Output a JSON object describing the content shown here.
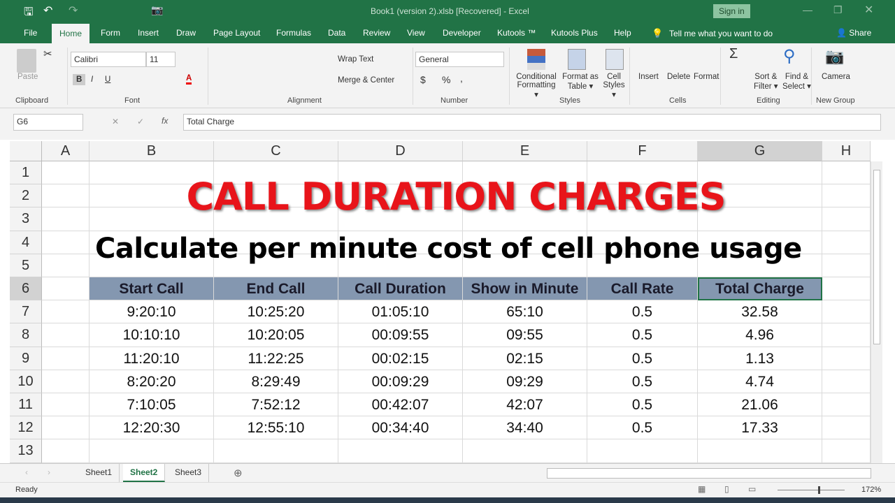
{
  "app": {
    "window_title": "Book1 (version 2).xlsb [Recovered]  -  Excel",
    "sign_in": "Sign in",
    "accent": "#217346"
  },
  "ribbon_tabs": [
    "File",
    "Home",
    "Form",
    "Insert",
    "Draw",
    "Page Layout",
    "Formulas",
    "Data",
    "Review",
    "View",
    "Developer",
    "Kutools ™",
    "Kutools Plus",
    "Help"
  ],
  "tell_me": "Tell me what you want to do",
  "share": "Share",
  "ribbon": {
    "paste": "Paste",
    "font_name": "Calibri",
    "font_size": "11",
    "bold": "B",
    "italic": "I",
    "underline": "U",
    "wrap_text": "Wrap Text",
    "merge_center": "Merge & Center",
    "number_format": "General",
    "currency": "$",
    "percent": "%",
    "comma": ",",
    "conditional": "Conditional",
    "formatting": "Formatting",
    "format_as": "Format as",
    "table": "Table",
    "cell": "Cell",
    "styles_btn": "Styles",
    "insert": "Insert",
    "delete": "Delete",
    "format": "Format",
    "sort": "Sort &",
    "filter": "Filter",
    "find": "Find &",
    "select": "Select",
    "camera": "Camera",
    "groups": [
      "Clipboard",
      "Font",
      "Alignment",
      "Number",
      "Styles",
      "Cells",
      "Editing",
      "New Group"
    ]
  },
  "formula_bar": {
    "name_box": "G6",
    "fx": "fx",
    "value": "Total Charge"
  },
  "columns": [
    "A",
    "B",
    "C",
    "D",
    "E",
    "F",
    "G",
    "H"
  ],
  "rows": [
    "1",
    "2",
    "3",
    "4",
    "5",
    "6",
    "7",
    "8",
    "9",
    "10",
    "11",
    "12",
    "13"
  ],
  "sheet_title": "CALL DURATION CHARGES",
  "sheet_subtitle": "Calculate per minute cost of cell phone usage",
  "table": {
    "header_color": "#8497b0",
    "headers": [
      "Start Call",
      "End Call",
      "Call Duration",
      "Show in Minute",
      "Call Rate",
      "Total Charge"
    ],
    "rows": [
      [
        "9:20:10",
        "10:25:20",
        "01:05:10",
        "65:10",
        "0.5",
        "32.58"
      ],
      [
        "10:10:10",
        "10:20:05",
        "00:09:55",
        "09:55",
        "0.5",
        "4.96"
      ],
      [
        "11:20:10",
        "11:22:25",
        "00:02:15",
        "02:15",
        "0.5",
        "1.13"
      ],
      [
        "8:20:20",
        "8:29:49",
        "00:09:29",
        "09:29",
        "0.5",
        "4.74"
      ],
      [
        "7:10:05",
        "7:52:12",
        "00:42:07",
        "42:07",
        "0.5",
        "21.06"
      ],
      [
        "12:20:30",
        "12:55:10",
        "00:34:40",
        "34:40",
        "0.5",
        "17.33"
      ]
    ]
  },
  "sheets": [
    "Sheet1",
    "Sheet2",
    "Sheet3"
  ],
  "active_sheet": "Sheet2",
  "status": {
    "ready": "Ready",
    "zoom": "172%"
  }
}
